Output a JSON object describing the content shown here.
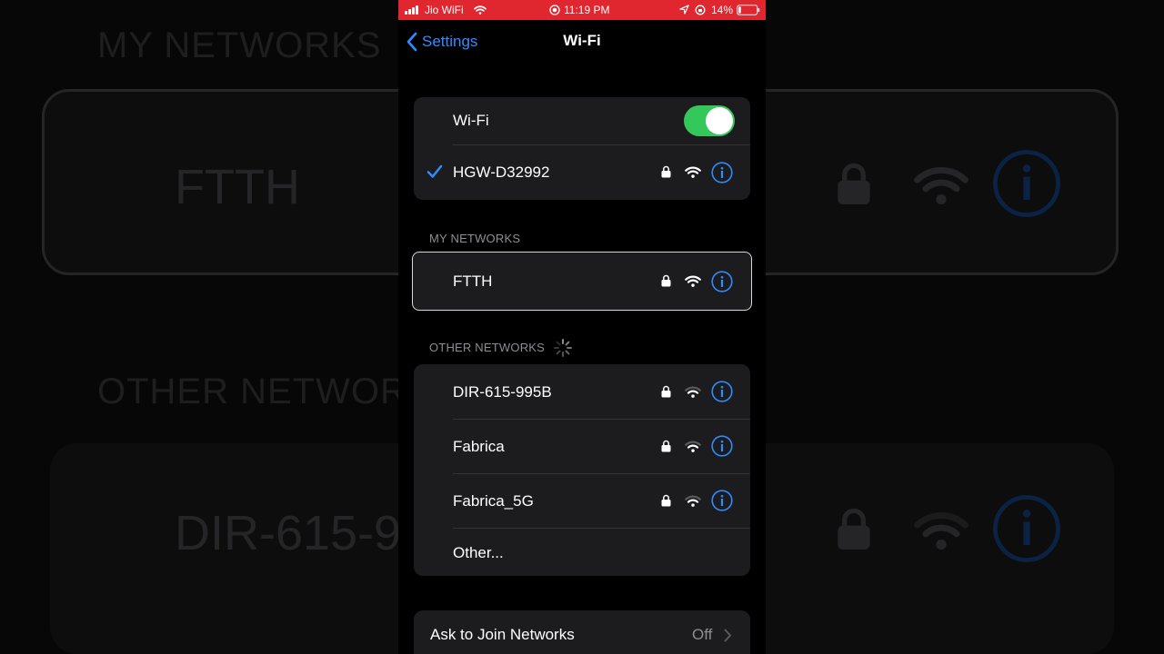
{
  "status_bar": {
    "carrier": "Jio WiFi",
    "time": "11:19 PM",
    "battery": "14%",
    "bar_color": "#e0262f"
  },
  "nav": {
    "back_label": "Settings",
    "title": "Wi-Fi"
  },
  "wifi_toggle": {
    "label": "Wi-Fi",
    "on": true,
    "on_color": "#34c759"
  },
  "connected_network": {
    "name": "HGW-D32992",
    "icons": [
      "checkmark-icon",
      "lock-icon",
      "wifi-signal-icon",
      "info-icon"
    ]
  },
  "my_networks": {
    "header": "MY NETWORKS",
    "items": [
      {
        "name": "FTTH"
      }
    ]
  },
  "other_networks": {
    "header": "OTHER NETWORKS",
    "items": [
      {
        "name": "DIR-615-995B"
      },
      {
        "name": "Fabrica"
      },
      {
        "name": "Fabrica_5G"
      }
    ],
    "other_label": "Other..."
  },
  "ask_to_join": {
    "label": "Ask to Join Networks",
    "value": "Off"
  },
  "background": {
    "head_my": "MY NETWORKS",
    "head_other": "OTHER NETWOR",
    "name_ftth": "FTTH",
    "name_dir": "DIR-615-9"
  },
  "colors": {
    "accent": "#2f8cff",
    "cell": "#1c1c1e",
    "secondary_text": "#8d8d93"
  }
}
